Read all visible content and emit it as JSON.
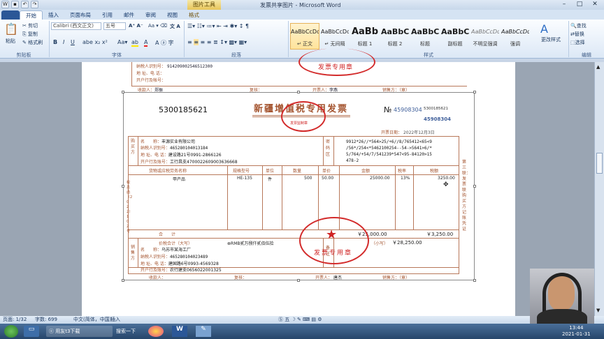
{
  "window": {
    "title": "发票共享图片 - Microsoft Word",
    "context_tab": "图片工具"
  },
  "ribbon_tabs": [
    "开始",
    "插入",
    "页面布局",
    "引用",
    "邮件",
    "审阅",
    "视图",
    "格式"
  ],
  "clipboard": {
    "paste": "粘贴",
    "cut": "剪切",
    "copy": "复制",
    "format_painter": "格式刷",
    "label": "剪贴板"
  },
  "font": {
    "name": "Calibri (西文正文)",
    "size": "五号",
    "label": "字体"
  },
  "paragraph": {
    "label": "段落"
  },
  "styles": {
    "label": "样式",
    "items": [
      {
        "sample": "AaBbCcDd",
        "name": "↵ 正文",
        "selected": true
      },
      {
        "sample": "AaBbCcDd",
        "name": "↵ 无间隔",
        "selected": false
      },
      {
        "sample": "AaBb",
        "name": "标题 1",
        "selected": false
      },
      {
        "sample": "AaBbC",
        "name": "标题 2",
        "selected": false
      },
      {
        "sample": "AaBbC",
        "name": "标题",
        "selected": false
      },
      {
        "sample": "AaBbC",
        "name": "副标题",
        "selected": false
      },
      {
        "sample": "AaBbCcDd",
        "name": "不明显强调",
        "selected": false
      },
      {
        "sample": "AaBbCcDd",
        "name": "强调",
        "selected": false
      }
    ],
    "change": "更改样式"
  },
  "editing": {
    "find": "查找",
    "replace": "替换",
    "select": "选择",
    "label": "编辑"
  },
  "prev_invoice": {
    "tax_id_label": "纳税人识别号：",
    "tax_id": "914209002546512300",
    "address_label": "地 址、电 话：",
    "bank_label": "开户行及帐号：",
    "payee_label": "收款人：",
    "payee": "郑振",
    "reviewer_label": "复核：",
    "drawer_label": "开票人：",
    "drawer": "李燕",
    "seller_label": "销售方：（章）",
    "stamp": "发票专用章"
  },
  "invoice": {
    "code": "5300185621",
    "title": "新疆增值税专用发票",
    "no_symbol": "№",
    "no": "45908304",
    "no_small": "5300185621",
    "no_small2": "45908304",
    "date_label": "开票日期：",
    "date": "2022年12月3日",
    "buyer_label": "购买方",
    "buyer": {
      "name_label": "名　　称：",
      "name": "丰源实业有限公司",
      "tax_label": "纳税人识别号：",
      "tax": "465280104013184",
      "addr_label": "地 址、电 话：",
      "addr": "建设路21号0991-2866126",
      "bank_label": "开户行及账号：",
      "bank": "工行昌支4700022609003636668"
    },
    "cipher_label": "密码区",
    "cipher": [
      "9912*26//*564>25/+6//8/765412<65<9",
      "/56*/254<*5462100254--54->5641>6/*",
      "5/764/+54/7/541239*547<95-84120>15",
      "478-2"
    ],
    "columns": [
      "货物或应税劳务名称",
      "规格型号",
      "单位",
      "数量",
      "单价",
      "金额",
      "税率",
      "税额"
    ],
    "item": {
      "name": "甲产品",
      "spec": "HE-135",
      "unit": "件",
      "qty": "500",
      "price": "50.00",
      "amount": "25000.00",
      "rate": "13%",
      "tax": "3250.00"
    },
    "total_label": "合　　计",
    "total_amount": "￥25,000.00",
    "total_tax": "￥3,250.00",
    "grand_label": "价税合计（大写）",
    "grand_words": "⊗RMB贰万捌仟贰佰伍拾",
    "grand_small_label": "（小写）",
    "grand_small": "￥28,250.00",
    "seller_label": "销售方",
    "seller": {
      "name_label": "名　　称：",
      "name": "乌苏市某海工厂",
      "tax_label": "纳税人识别号：",
      "tax": "465280104023489",
      "addr_label": "地 址、电 话：",
      "addr": "建国路6号0993-4569328",
      "bank_label": "开户行及账号：",
      "bank": "农行建支0656022001325"
    },
    "remark_label": "备注",
    "payee_label": "收款人：",
    "reviewer_label": "复核：",
    "drawer_label": "开票人：",
    "drawer": "唐杰",
    "seal_label": "销售方：（章）",
    "side_right": [
      "第三联：",
      "发票联",
      "购买方记账凭证"
    ],
    "side_left": "税总函〔2022〕102号",
    "stamp_text": "发票专用章",
    "seal_top": "发票监制章"
  },
  "statusbar": {
    "page": "页面: 1/32",
    "words": "字数: 699",
    "lang": "中文(简体，中国)",
    "mode": "插入"
  },
  "taskbar": {
    "item1": "用友t3下载",
    "search": "搜索一下",
    "time": "13:44",
    "date": "2021-01-31"
  }
}
